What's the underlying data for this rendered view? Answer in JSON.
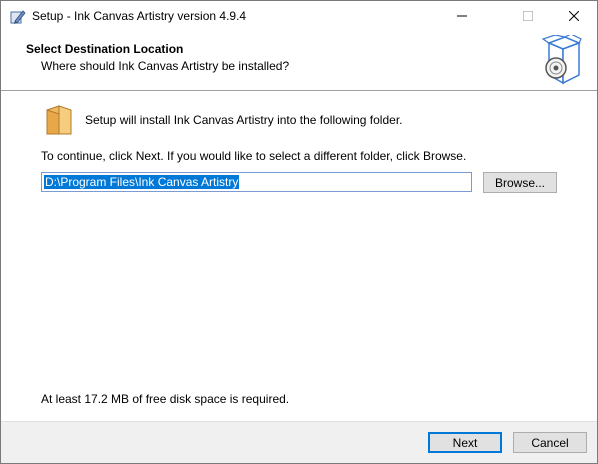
{
  "window": {
    "title": "Setup - Ink Canvas Artistry version 4.9.4"
  },
  "header": {
    "title": "Select Destination Location",
    "subtitle": "Where should Ink Canvas Artistry be installed?",
    "icon": "installer-box-disc-icon"
  },
  "content": {
    "install_text": "Setup will install Ink Canvas Artistry into the following folder.",
    "continue_text": "To continue, click Next. If you would like to select a different folder, click Browse.",
    "path_value": "D:\\Program Files\\Ink Canvas Artistry",
    "browse_label": "Browse...",
    "disk_space_text": "At least 17.2 MB of free disk space is required.",
    "folder_icon": "folder-icon"
  },
  "footer": {
    "next_label": "Next",
    "cancel_label": "Cancel"
  },
  "colors": {
    "accent": "#0078d7",
    "footer_bg": "#f0f0f0",
    "button_bg": "#e1e1e1"
  }
}
